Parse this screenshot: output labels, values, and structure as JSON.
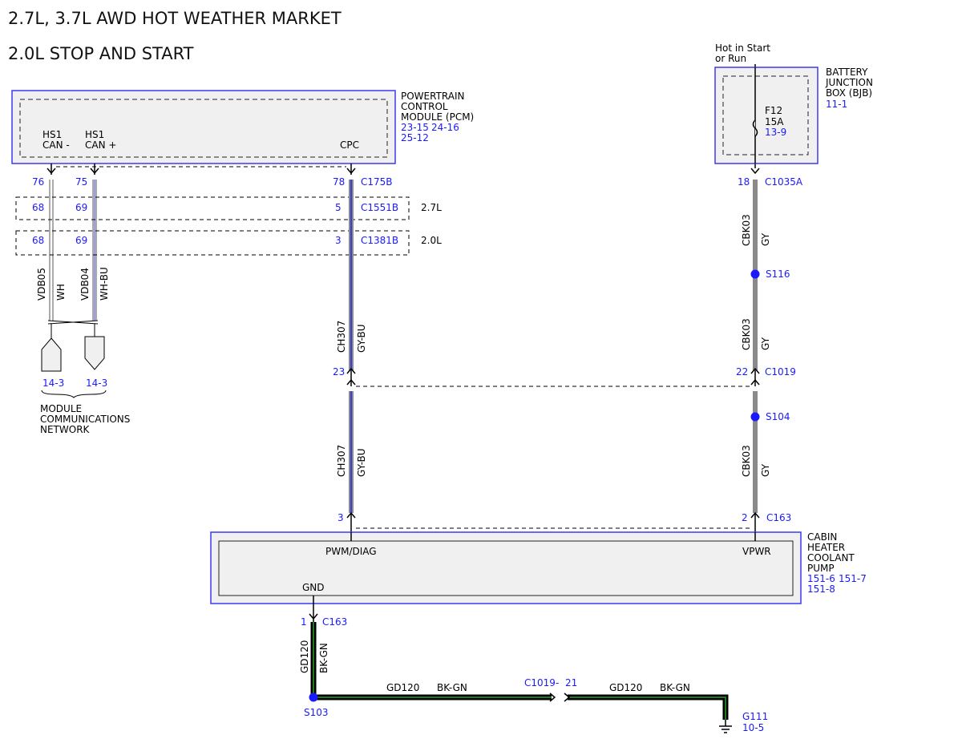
{
  "titles": {
    "line1": "2.7L, 3.7L AWD HOT WEATHER MARKET",
    "line2": "2.0L STOP AND START"
  },
  "colors": {
    "ref_blue": "#1a1aff",
    "wire_gray": "#8a8a8a",
    "wire_blue": "#3c3cd0",
    "wire_green": "#1f7a1f",
    "box_border": "#3a3af0",
    "box_fill": "#f0f0f0"
  },
  "pcm": {
    "name": [
      "POWERTRAIN",
      "CONTROL",
      "MODULE (PCM)"
    ],
    "refs": [
      "23-15",
      "24-16",
      "25-12"
    ],
    "pins": {
      "hs1_can_minus": [
        "HS1",
        "CAN -"
      ],
      "hs1_can_plus": [
        "HS1",
        "CAN +"
      ],
      "cpc": "CPC"
    }
  },
  "bjb": {
    "supply_note": [
      "Hot in Start",
      "or Run"
    ],
    "name": [
      "BATTERY",
      "JUNCTION",
      "BOX (BJB)"
    ],
    "ref": "11-1",
    "fuse": {
      "id": "F12",
      "rating": "15A",
      "ref": "13-9"
    }
  },
  "connectors": {
    "c175b": {
      "label": "C175B",
      "pin_can_minus": "76",
      "pin_can_plus": "75",
      "pin_cpc": "78"
    },
    "c1551b": {
      "label": "C1551B",
      "pin_a": "68",
      "pin_b": "69",
      "pin_cpc": "5",
      "variant": "2.7L"
    },
    "c1381b": {
      "label": "C1381B",
      "pin_a": "68",
      "pin_b": "69",
      "pin_cpc": "3",
      "variant": "2.0L"
    },
    "c1035a": {
      "label": "C1035A",
      "pin": "18"
    },
    "c1019": {
      "label": "C1019",
      "pin_left": "23",
      "pin_right": "22"
    },
    "c163": {
      "label": "C163",
      "pin_left": "3",
      "pin_right": "2",
      "pin_gnd": "1"
    }
  },
  "wires": {
    "vdb05": {
      "circuit": "VDB05",
      "color": "WH"
    },
    "vdb04": {
      "circuit": "VDB04",
      "color": "WH-BU"
    },
    "ch307": {
      "circuit": "CH307",
      "color": "GY-BU"
    },
    "cbk03": {
      "circuit": "CBK03",
      "color": "GY"
    },
    "gd120": {
      "circuit": "GD120",
      "color": "BK-GN"
    }
  },
  "splices": {
    "s116": "S116",
    "s104": "S104",
    "s103": "S103"
  },
  "network": {
    "ref_left": "14-3",
    "ref_right": "14-3",
    "label": [
      "MODULE",
      "COMMUNICATIONS",
      "NETWORK"
    ]
  },
  "pump": {
    "name": [
      "CABIN",
      "HEATER",
      "COOLANT",
      "PUMP"
    ],
    "refs": [
      "151-6",
      "151-7",
      "151-8"
    ],
    "pins": {
      "pwm": "PWM/DIAG",
      "vpwr": "VPWR",
      "gnd": "GND"
    }
  },
  "ground": {
    "inline_conn": "C1019",
    "dash": "-",
    "inline_pin": "21",
    "point": "G111",
    "ref": "10-5"
  }
}
